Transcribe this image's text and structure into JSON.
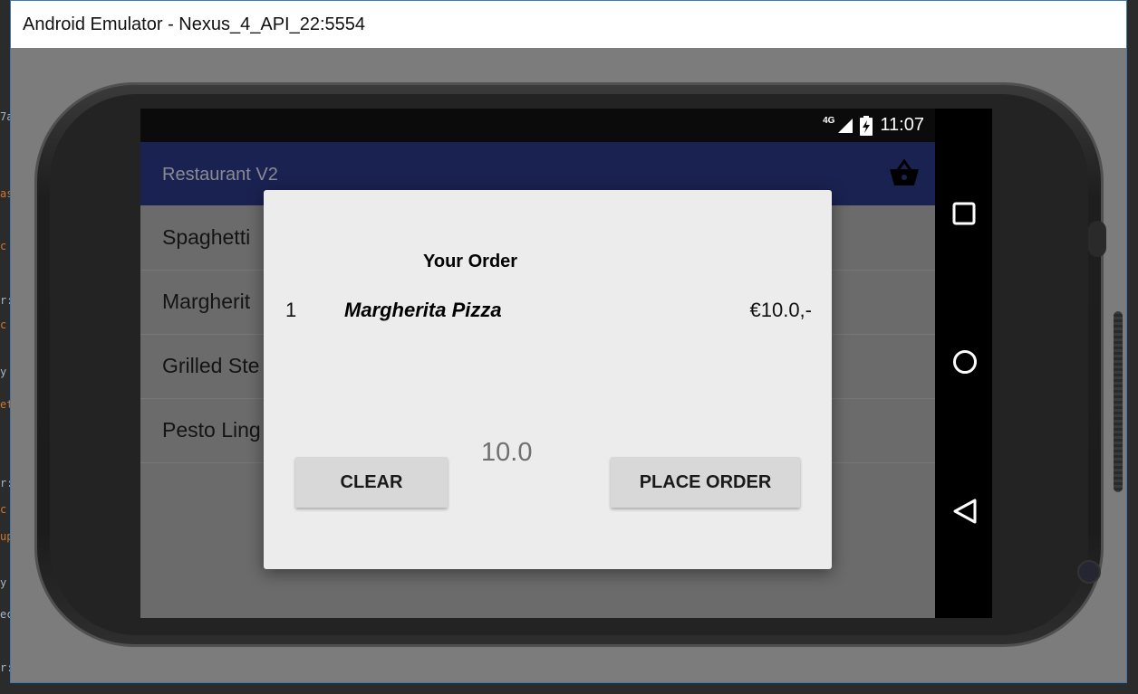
{
  "window": {
    "title": "Android Emulator - Nexus_4_API_22:5554"
  },
  "ide_background": {
    "glyphs": [
      "7a",
      "as",
      "c",
      "r:",
      "c",
      "y",
      "et",
      "r:",
      "c",
      "up",
      "y",
      "ec",
      "r:"
    ]
  },
  "status_bar": {
    "network": "4G",
    "time": "11:07"
  },
  "app_bar": {
    "title": "Restaurant V2",
    "action_icon": "basket-icon"
  },
  "menu_list": {
    "items": [
      "Spaghetti",
      "Margherit",
      "Grilled Ste",
      "Pesto Ling"
    ]
  },
  "dialog": {
    "title": "Your Order",
    "order_items": [
      {
        "quantity": "1",
        "name": "Margherita Pizza",
        "price": "€10.0,-"
      }
    ],
    "total": "10.0",
    "clear_label": "CLEAR",
    "place_order_label": "PLACE ORDER"
  },
  "nav_bar": {
    "icons": [
      "recents-square-icon",
      "home-circle-icon",
      "back-triangle-icon"
    ]
  },
  "colors": {
    "app_bar": "#1a2251",
    "dialog_bg": "#ececec",
    "button_bg": "#d8d8d8",
    "window_border": "#3b79b8"
  }
}
